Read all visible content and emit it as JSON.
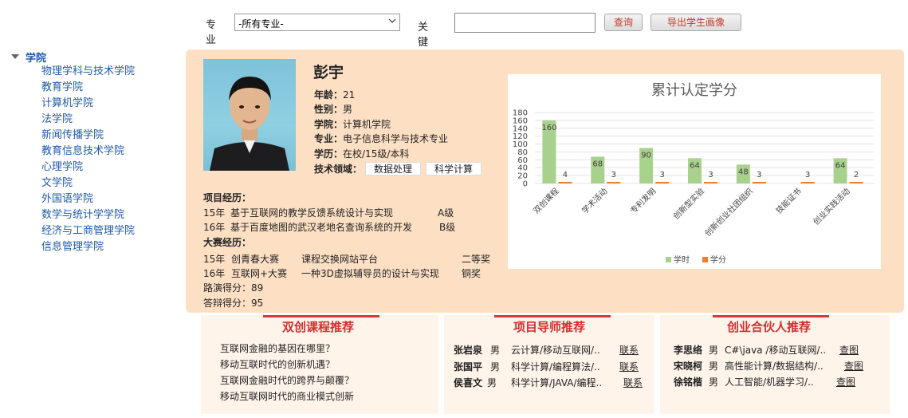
{
  "search": {
    "major_label": "专业",
    "major_selected": "-所有专业-",
    "keyword_label": "关键词",
    "keyword_value": "",
    "query_button": "查询",
    "export_button": "导出学生画像"
  },
  "sidebar": {
    "root": "学院",
    "items": [
      {
        "label": "物理学科与技术学院"
      },
      {
        "label": "教育学院"
      },
      {
        "label": "计算机学院"
      },
      {
        "label": "法学院"
      },
      {
        "label": "新闻传播学院"
      },
      {
        "label": "教育信息技术学院"
      },
      {
        "label": "心理学院"
      },
      {
        "label": "文学院"
      },
      {
        "label": "外国语学院"
      },
      {
        "label": "数学与统计学学院"
      },
      {
        "label": "经济与工商管理学院"
      },
      {
        "label": "信息管理学院"
      }
    ]
  },
  "profile": {
    "name": "彭宇",
    "age_label": "年龄：",
    "age": "21",
    "gender_label": "性别：",
    "gender": "男",
    "college_label": "学院：",
    "college": "计算机学院",
    "major_label": "专业：",
    "major": "电子信息科学与技术专业",
    "degree_label": "学历：",
    "degree": "在校/15级/本科",
    "tech_label": "技术领域：",
    "tech_tags": [
      "数据处理",
      "科学计算"
    ],
    "projects_title": "项目经历：",
    "projects": [
      {
        "year": "15年",
        "name": "基于互联网的教学反馈系统设计与实现",
        "grade": "A级"
      },
      {
        "year": "16年",
        "name": "基于百度地图的武汉老地名查询系统的开发",
        "grade": "B级"
      }
    ],
    "contests_title": "大赛经历：",
    "contests": [
      {
        "year": "15年",
        "contest": "创青春大赛",
        "work": "课程交换网站平台",
        "award": "二等奖"
      },
      {
        "year": "16年",
        "contest": "互联网+大赛",
        "work": "一种3D虚拟辅导员的设计与实现",
        "award": "铜奖"
      }
    ],
    "roadshow": "路演得分：89",
    "defense": "答辩得分：95"
  },
  "chart_data": {
    "type": "bar",
    "title": "累计认定学分",
    "categories": [
      "双创课程",
      "学术活动",
      "专利发明",
      "创新型实验",
      "创新创业社团组织",
      "技能证书",
      "创业实践活动"
    ],
    "series": [
      {
        "name": "学时",
        "values": [
          160,
          68,
          90,
          64,
          48,
          0,
          64
        ],
        "color": "#a9d18e"
      },
      {
        "name": "学分",
        "values": [
          4,
          3,
          3,
          3,
          3,
          3,
          2
        ],
        "color": "#ed7d31"
      }
    ],
    "data_labels": [
      [
        "160",
        "68",
        "90",
        "64",
        "48",
        "",
        "64"
      ],
      [
        "4",
        "3",
        "3",
        "3",
        "3",
        "3",
        "2"
      ]
    ],
    "y_ticks": [
      "180",
      "160",
      "140",
      "120",
      "100",
      "80",
      "60",
      "40",
      "20",
      "0"
    ],
    "ylim": [
      0,
      180
    ],
    "legend": "bottom"
  },
  "cards": {
    "courses": {
      "title": "双创课程推荐",
      "items": [
        "互联网金融的基因在哪里？",
        "移动互联时代的创新机遇？",
        "互联网金融时代的跨界与颠覆？",
        "移动互联网时代的商业模式创新"
      ]
    },
    "mentors": {
      "title": "项目导师推荐",
      "items": [
        {
          "name": "张岩泉",
          "gender": "男",
          "desc": "云计算/移动互联网/..",
          "action": "联系"
        },
        {
          "name": "张国平",
          "gender": "男",
          "desc": "科学计算/编程算法/..",
          "action": "联系"
        },
        {
          "name": "侯喜文",
          "gender": "男",
          "desc": "科学计算/JAVA/编程..",
          "action": "联系"
        }
      ]
    },
    "partners": {
      "title": "创业合伙人推荐",
      "items": [
        {
          "name": "李思络",
          "gender": "男",
          "desc": "C#\\java /移动互联网/..",
          "action": "查图"
        },
        {
          "name": "宋晓柯",
          "gender": "男",
          "desc": "高性能计算/数据结构/..",
          "action": "查图"
        },
        {
          "name": "徐铭楷",
          "gender": "男",
          "desc": "人工智能/机器学习/..",
          "action": "查图"
        }
      ]
    }
  }
}
